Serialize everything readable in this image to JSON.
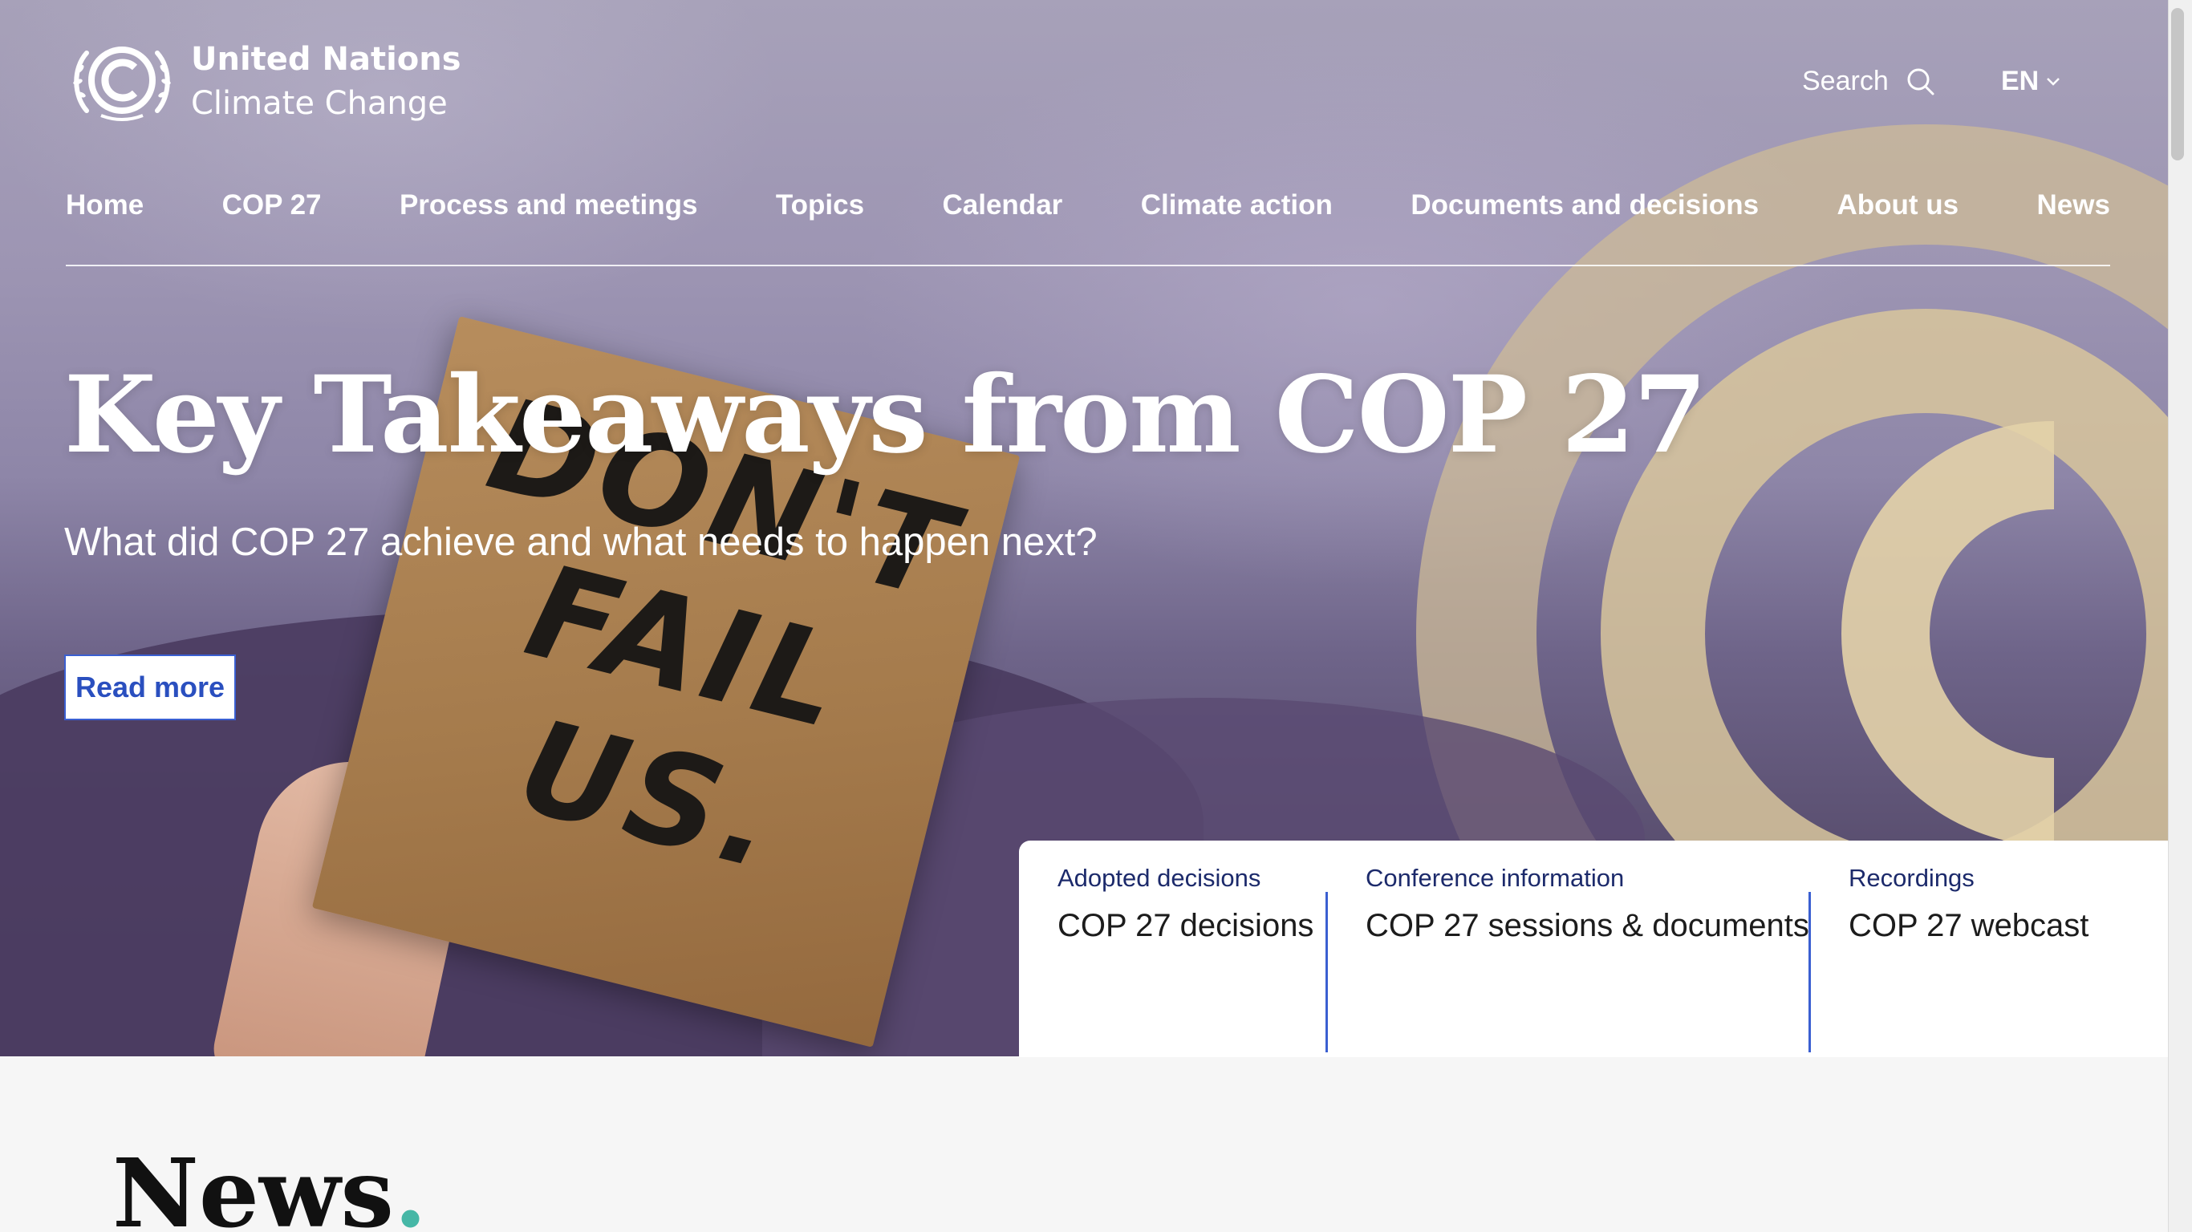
{
  "header": {
    "logo_line1": "United Nations",
    "logo_line2": "Climate Change",
    "search_label": "Search",
    "language": "EN"
  },
  "nav": {
    "items": [
      "Home",
      "COP 27",
      "Process and meetings",
      "Topics",
      "Calendar",
      "Climate action",
      "Documents and decisions",
      "About us",
      "News"
    ]
  },
  "hero": {
    "title": "Key Takeaways from COP 27",
    "subtitle": "What did COP 27 achieve and what needs to happen next?",
    "cta_label": "Read more",
    "sign_lines": [
      "DON'T",
      "FAIL",
      "US."
    ]
  },
  "quick_links": [
    {
      "label": "Adopted decisions",
      "title": "COP 27 decisions"
    },
    {
      "label": "Conference information",
      "title": "COP 27 sessions & documents"
    },
    {
      "label": "Recordings",
      "title": "COP 27 webcast"
    }
  ],
  "news": {
    "heading": "News",
    "dot": "."
  },
  "colors": {
    "accent_blue": "#3a5fd1",
    "label_navy": "#1c2a6b",
    "news_dot_teal": "#46b7a6"
  }
}
